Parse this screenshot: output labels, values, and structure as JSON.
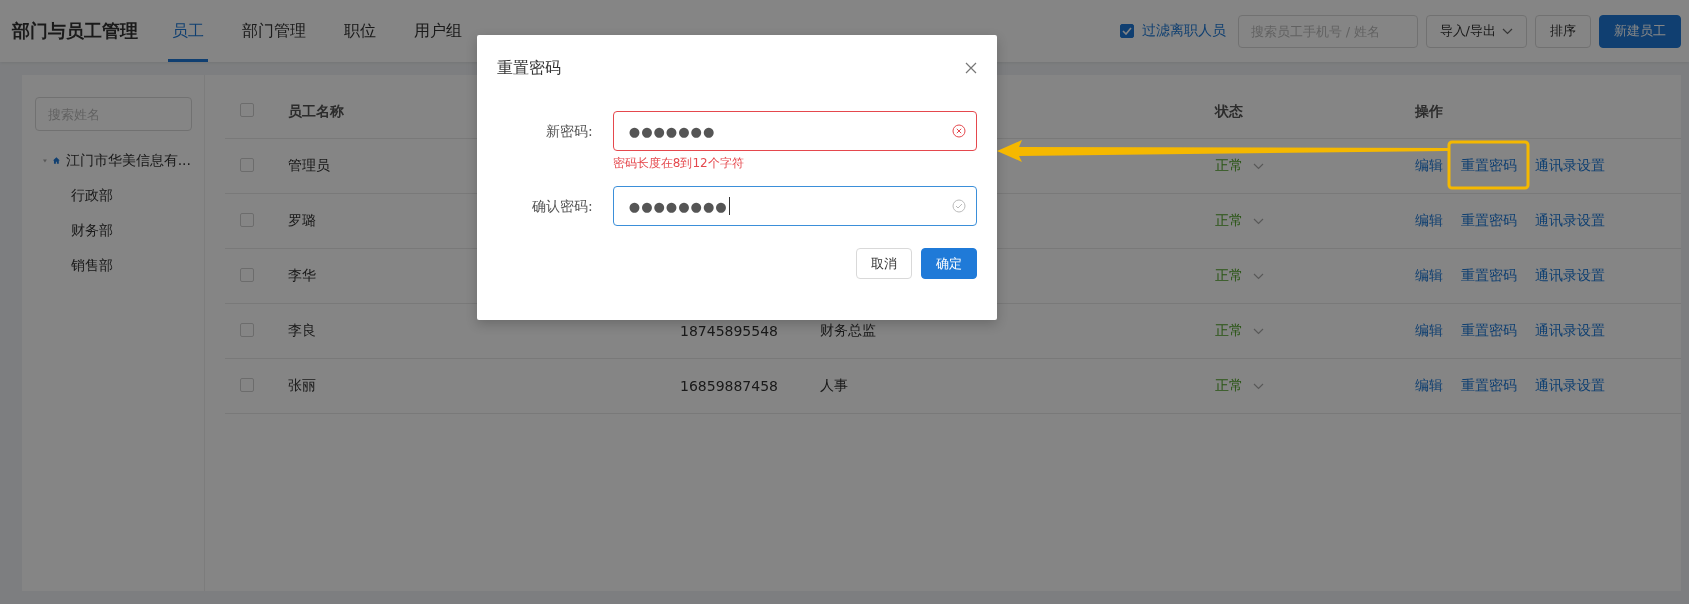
{
  "header": {
    "title": "部门与员工管理",
    "tabs": [
      {
        "label": "员工",
        "selected": true
      },
      {
        "label": "部门管理",
        "selected": false
      },
      {
        "label": "职位",
        "selected": false
      },
      {
        "label": "用户组",
        "selected": false
      }
    ],
    "filter": {
      "label": "过滤离职人员",
      "checked": true
    },
    "search": {
      "placeholder": "搜索员工手机号 / 姓名"
    },
    "buttons": [
      {
        "label": "导入/导出",
        "kind": "dropdown"
      },
      {
        "label": "排序",
        "kind": "default"
      },
      {
        "label": "新建员工",
        "kind": "primary"
      }
    ]
  },
  "sidebar": {
    "search": {
      "placeholder": "搜索姓名"
    },
    "tree": [
      {
        "label": "江门市华美信息有...",
        "expanded": true,
        "children": [
          {
            "label": "行政部"
          },
          {
            "label": "财务部"
          },
          {
            "label": "销售部"
          }
        ]
      }
    ]
  },
  "table": {
    "select_all": {
      "checked": false
    },
    "columns": [
      {
        "label": "员工名称"
      },
      {
        "label": "状态"
      },
      {
        "label": "操作"
      }
    ],
    "rows": [
      {
        "checked": false,
        "name": "管理员",
        "status": "正常",
        "actions": [
          "编辑",
          "重置密码",
          "通讯录设置"
        ]
      },
      {
        "checked": false,
        "name": "罗璐",
        "status": "正常",
        "actions": [
          "编辑",
          "重置密码",
          "通讯录设置"
        ]
      },
      {
        "checked": false,
        "name": "李华",
        "status": "正常",
        "actions": [
          "编辑",
          "重置密码",
          "通讯录设置"
        ]
      },
      {
        "checked": false,
        "name": "李良",
        "phone": "18745895548",
        "position": "财务总监",
        "status": "正常",
        "actions": [
          "编辑",
          "重置密码",
          "通讯录设置"
        ]
      },
      {
        "checked": false,
        "name": "张丽",
        "phone": "16859887458",
        "position": "人事",
        "status": "正常",
        "actions": [
          "编辑",
          "重置密码",
          "通讯录设置"
        ]
      }
    ]
  },
  "dialog": {
    "title": "重置密码",
    "fields": [
      {
        "label": "新密码:",
        "value": "●●●●●●●",
        "invalid": true,
        "focused": false,
        "error": "密码长度在8到12个字符"
      },
      {
        "label": "确认密码:",
        "value": "●●●●●●●●",
        "invalid": false,
        "focused": true
      }
    ],
    "buttons": [
      {
        "label": "取消",
        "kind": "default"
      },
      {
        "label": "确定",
        "kind": "primary"
      }
    ]
  }
}
